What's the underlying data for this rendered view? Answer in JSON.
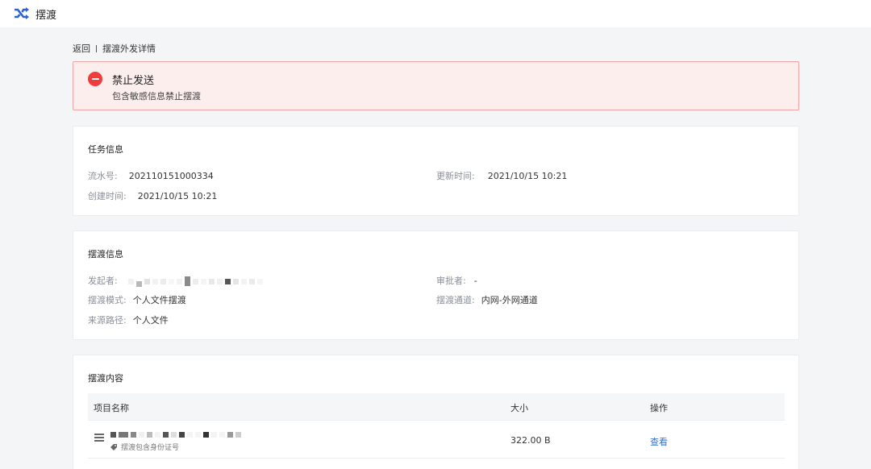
{
  "header": {
    "app_title": "摆渡",
    "logo_icon": "shuffle-icon",
    "accent": "#2a62d4"
  },
  "breadcrumb": {
    "back": "返回",
    "current": "摆渡外发详情"
  },
  "alert": {
    "title": "禁止发送",
    "desc": "包含敏感信息禁止摆渡",
    "color": "#ef3d3d"
  },
  "task": {
    "title": "任务信息",
    "serial_label": "流水号:",
    "serial_value": "202110151000334",
    "updated_label": "更新时间:",
    "updated_value": "2021/10/15 10:21",
    "created_label": "创建时间:",
    "created_value": "2021/10/15 10:21"
  },
  "ferry": {
    "title": "摆渡信息",
    "initiator_label": "发起者:",
    "approver_label": "审批者:",
    "approver_value": "-",
    "mode_label": "摆渡模式:",
    "mode_value": "个人文件摆渡",
    "channel_label": "摆渡通道:",
    "channel_value": "内网-外网通道",
    "source_label": "来源路径:",
    "source_value": "个人文件"
  },
  "content": {
    "title": "摆渡内容",
    "columns": [
      "项目名称",
      "大小",
      "操作"
    ],
    "rows": [
      {
        "tag": "摆渡包含身份证号",
        "size": "322.00 B",
        "action": "查看"
      }
    ]
  }
}
